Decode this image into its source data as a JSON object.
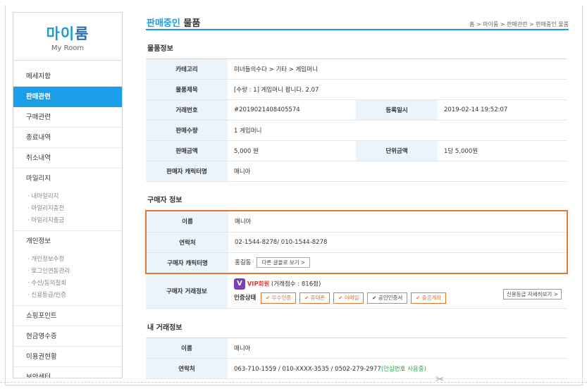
{
  "sidebar": {
    "title_a": "마이",
    "title_b": "룸",
    "subtitle": "My Room",
    "menu": [
      "메세지함",
      "판매관련",
      "구매관련",
      "종료내역",
      "취소내역",
      "마일리지"
    ],
    "mileage_sub": [
      "· 내마일리지",
      "· 마일리지충전",
      "· 마일리지출금"
    ],
    "personal": "개인정보",
    "personal_sub": [
      "· 개인정보수정",
      "· 로그인연동관리",
      "· 수신/동의철회",
      "· 신용등급/인증"
    ],
    "menu2": [
      "쇼핑포인트",
      "현금영수증",
      "이용권현황",
      "보안센터"
    ]
  },
  "header": {
    "title_highlight": "판매중인",
    "title_rest": " 물품",
    "breadcrumb": "홈 > 마이룸 > 판매관련 > 판매중인 물품"
  },
  "item_info": {
    "section": "물품정보",
    "category_label": "카테고리",
    "category": "미녀들의수다 > 기타 > 게임머니",
    "title_label": "물품제목",
    "title": "[수량 : 1] 게임머니 팝니다. 2.07",
    "trade_no_label": "거래번호",
    "trade_no": "#2019021408405574",
    "reg_date_label": "등록일시",
    "reg_date": "2019-02-14 19:52:07",
    "qty_label": "판매수량",
    "qty": "1 게임머니",
    "price_label": "판매금액",
    "price": "5,000 원",
    "unit_label": "단위금액",
    "unit": "1당 5,000원",
    "seller_char_label": "판매자 캐릭터명",
    "seller_char": "매니아"
  },
  "buyer": {
    "section": "구매자 정보",
    "name_label": "이름",
    "name": "매니아",
    "contact_label": "연락처",
    "contact": "02-1544-8278/ 010-1544-8278",
    "char_label": "구매자 캐릭터명",
    "char": "홍길동",
    "char_btn": "다른 글꼴로 보기 >",
    "trade_info_label": "구매자 거래정보",
    "vip_badge": "V",
    "vip": "VIP회원",
    "score": "(거래점수 : 816점)",
    "auth_label": "인증상태",
    "auth": [
      "✔ 우수인증",
      "✔ 휴대폰",
      "✔ 이메일",
      "✔ 공인인증서",
      "✔ 출금계좌"
    ],
    "credit_btn": "신용등급 자세히보기 >"
  },
  "my_trade": {
    "section": "내 거래정보",
    "name_label": "이름",
    "name": "매니아",
    "contact_label": "연락처",
    "contact": "063-710-1559 / 010-XXXX-3535 / 0502-279-2977",
    "safe": "(안심번호 사용중)"
  },
  "colors": {
    "accent": "#1a9ee9",
    "highlight_border": "#e5762f",
    "vip": "#7b3fb4"
  },
  "icons": {
    "vip": "vip-badge-icon",
    "cut": "scissors-icon"
  }
}
